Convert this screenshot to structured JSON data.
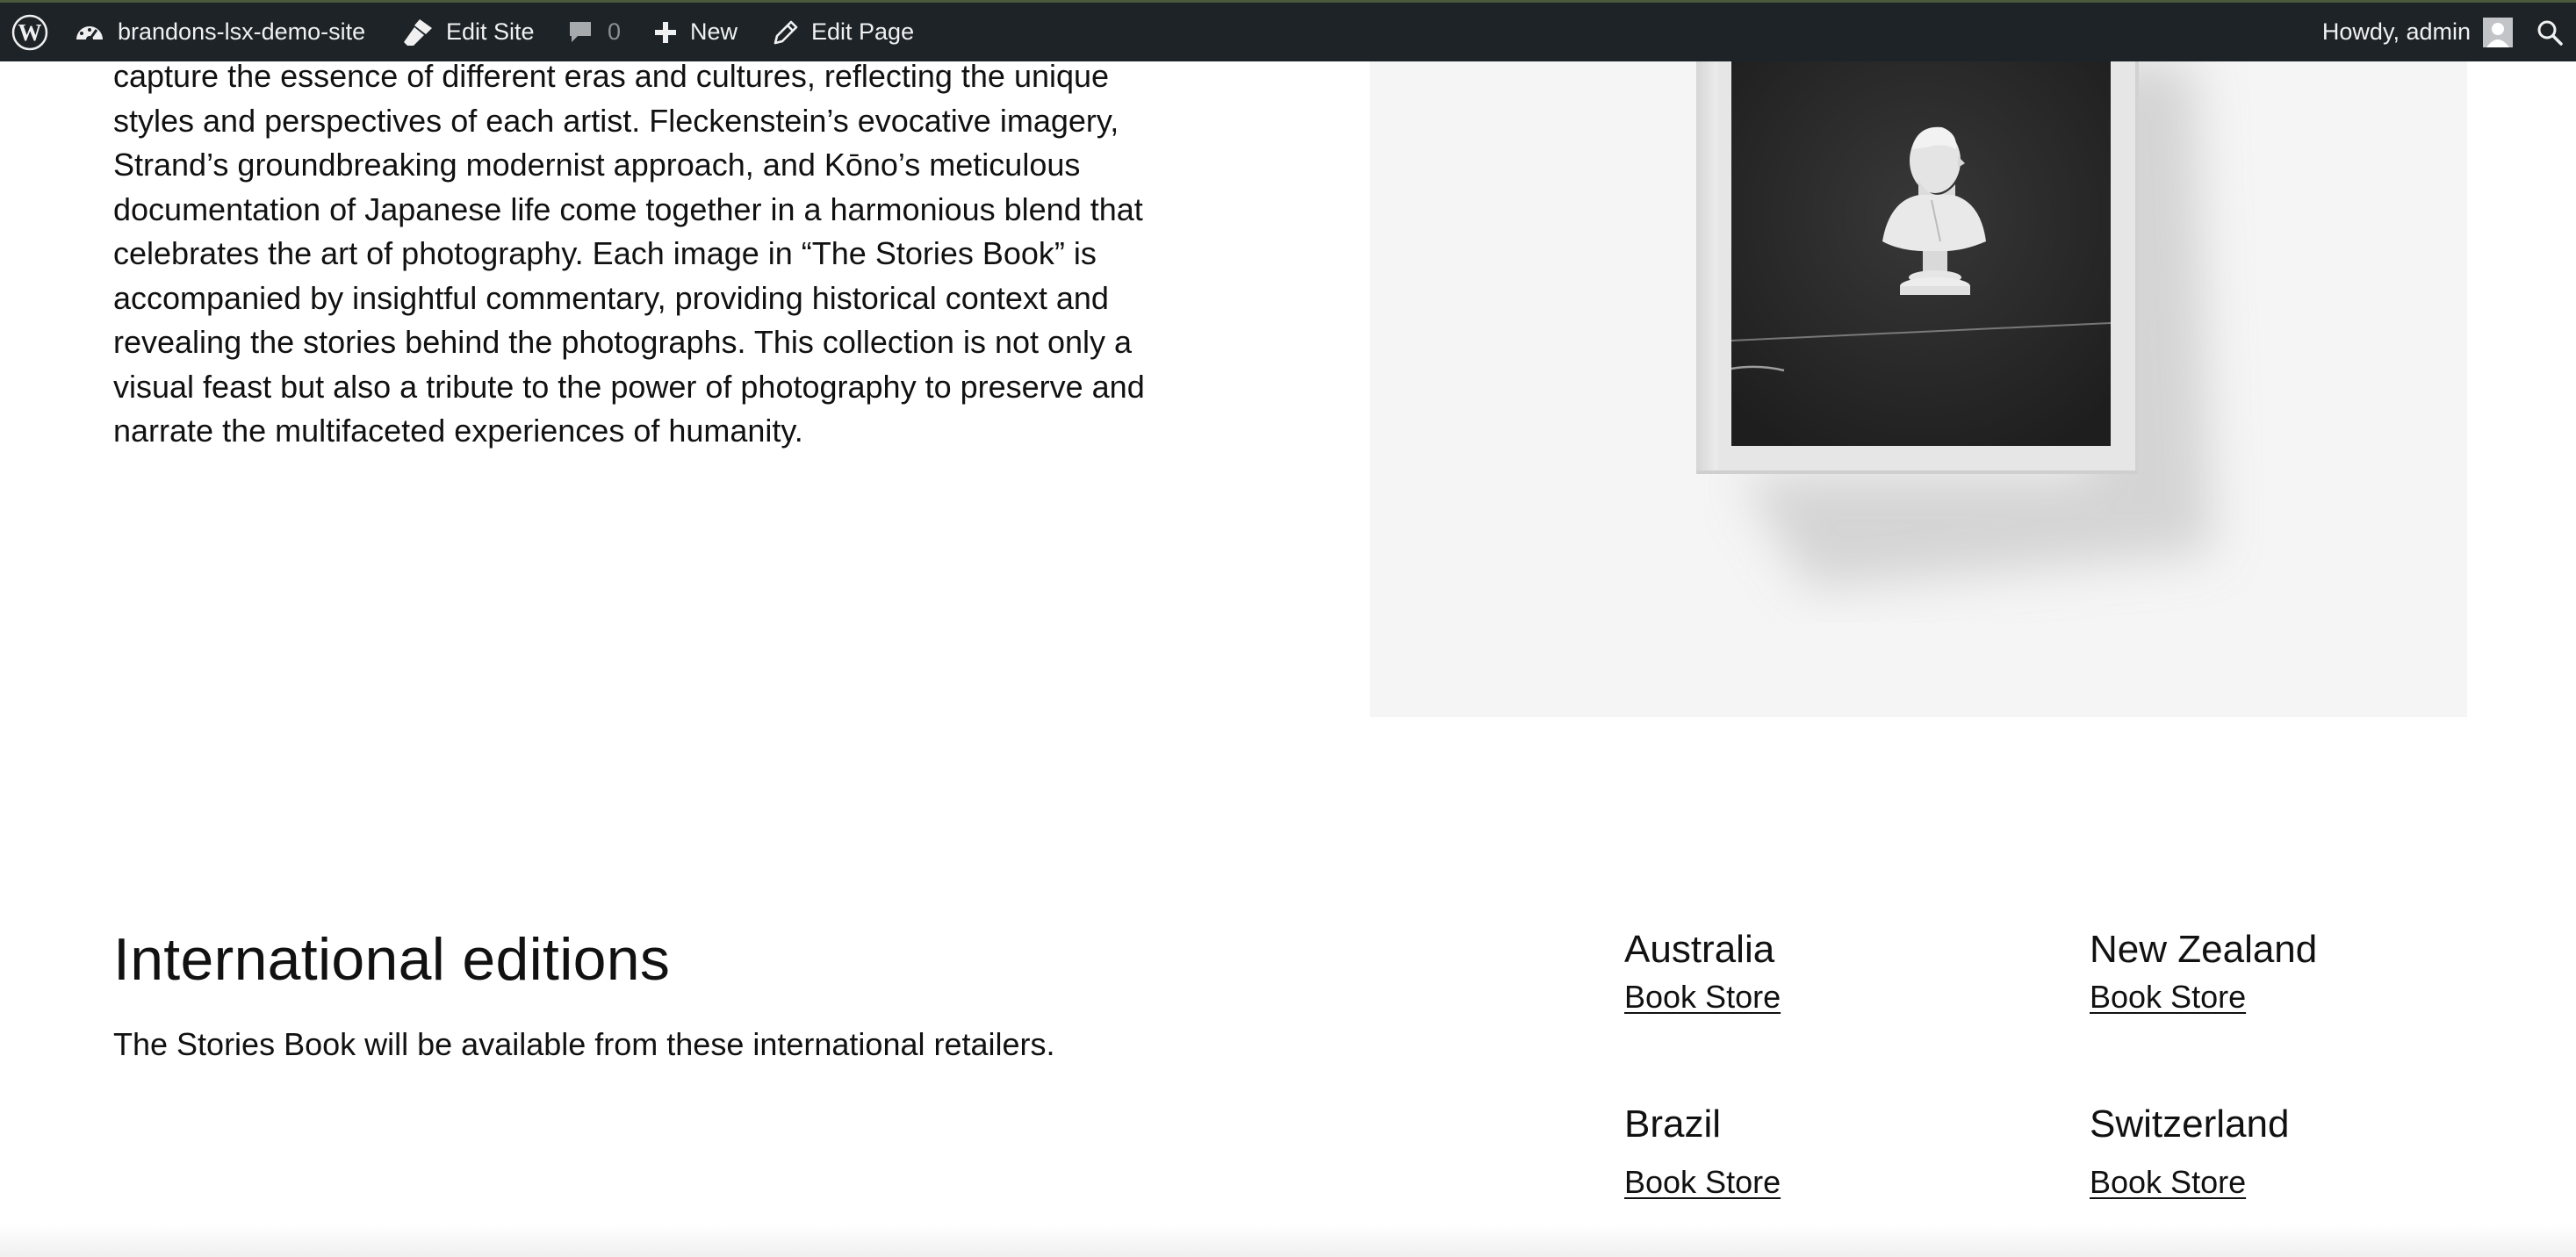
{
  "adminbar": {
    "site_name": "brandons-lsx-demo-site",
    "edit_site": "Edit Site",
    "comments_count": "0",
    "new_label": "New",
    "edit_page": "Edit Page",
    "howdy": "Howdy, admin",
    "icons": {
      "wordpress": "wordpress-logo-icon",
      "dashboard": "dashboard-icon",
      "edit_site": "brush-icon",
      "comments": "comment-bubble-icon",
      "new": "plus-icon",
      "edit_page": "pencil-icon",
      "search": "search-icon"
    },
    "colors": {
      "background": "#1d2327",
      "text": "#f0f0f1",
      "muted": "#8c8f94"
    }
  },
  "intro": {
    "paragraph": "capture the essence of different eras and cultures, reflecting the unique styles and perspectives of each artist. Fleckenstein’s evocative imagery, Strand’s groundbreaking modernist approach, and Kōno’s meticulous documentation of Japanese life come together in a harmonious blend that celebrates the art of photography. Each image in “The Stories Book” is accompanied by insightful commentary, providing historical context and revealing the stories behind the photographs. This collection is not only a visual feast but also a tribute to the power of photography to preserve and narrate the multifaceted experiences of humanity."
  },
  "international": {
    "title": "International editions",
    "description": "The Stories Book will be available from these international retailers.",
    "retailers": [
      {
        "country": "Australia",
        "link": "Book Store"
      },
      {
        "country": "New Zealand",
        "link": "Book Store"
      },
      {
        "country": "Brazil",
        "link": "Book Store"
      },
      {
        "country": "Switzerland",
        "link": "Book Store"
      }
    ]
  }
}
